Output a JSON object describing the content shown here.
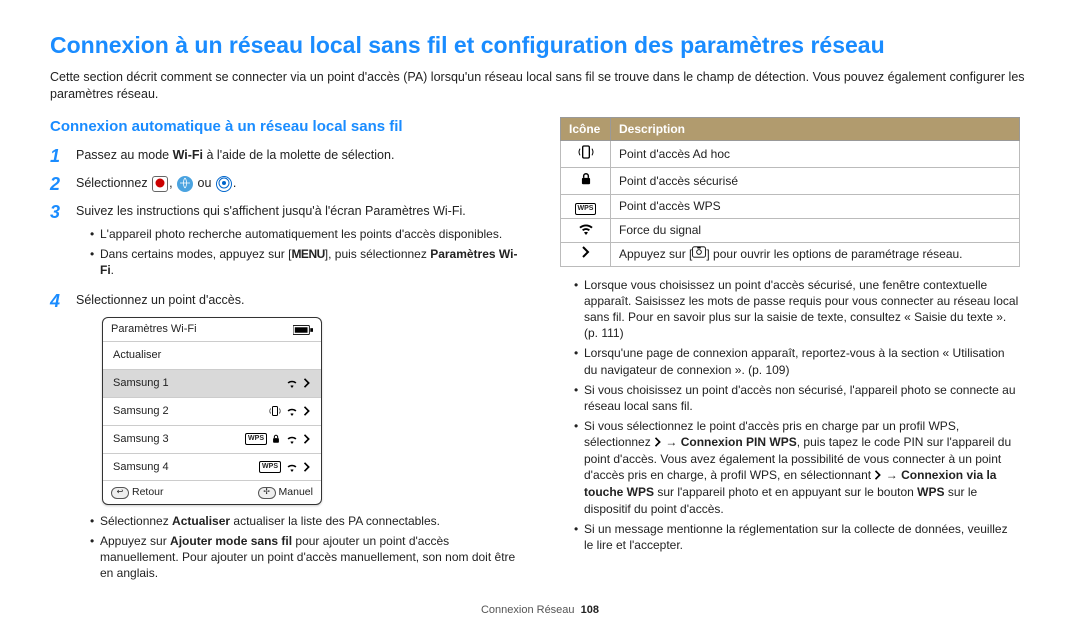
{
  "page_title": "Connexion à un réseau local sans fil et configuration des paramètres réseau",
  "intro": "Cette section décrit comment se connecter via un point d'accès (PA) lorsqu'un réseau local sans fil se trouve dans le champ de détection. Vous pouvez également configurer les paramètres réseau.",
  "subheading": "Connexion automatique à un réseau local sans fil",
  "steps": {
    "n1": "1",
    "s1_a": "Passez au mode ",
    "s1_wifi": "Wi-Fi",
    "s1_b": " à l'aide de la molette de sélection.",
    "n2": "2",
    "s2_a": "Sélectionnez ",
    "s2_b": ", ",
    "s2_c": " ou ",
    "s2_d": ".",
    "n3": "3",
    "s3": "Suivez les instructions qui s'affichent jusqu'à l'écran Paramètres Wi-Fi.",
    "s3_b1": "L'appareil photo recherche automatiquement les points d'accès disponibles.",
    "s3_b2_a": "Dans certains modes, appuyez sur [",
    "s3_b2_menu": "MENU",
    "s3_b2_b": "], puis sélectionnez ",
    "s3_b2_bold": "Paramètres Wi-Fi",
    "s3_b2_c": ".",
    "n4": "4",
    "s4": "Sélectionnez un point d'accès.",
    "s4_b1_a": "Sélectionnez ",
    "s4_b1_bold": "Actualiser",
    "s4_b1_b": " actualiser la liste des PA connectables.",
    "s4_b2_a": "Appuyez sur ",
    "s4_b2_bold": "Ajouter mode sans fil",
    "s4_b2_b": " pour ajouter un point d'accès manuellement. Pour ajouter un point d'accès manuellement, son nom doit être en anglais."
  },
  "device": {
    "title": "Paramètres Wi-Fi",
    "refresh": "Actualiser",
    "rows": [
      "Samsung 1",
      "Samsung 2",
      "Samsung 3",
      "Samsung 4"
    ],
    "back": "Retour",
    "manual": "Manuel"
  },
  "table": {
    "h_icon": "Icône",
    "h_desc": "Description",
    "r1": "Point d'accès Ad hoc",
    "r2": "Point d'accès sécurisé",
    "r3": "Point d'accès WPS",
    "r4": "Force du signal",
    "r5_a": "Appuyez sur [",
    "r5_b": "] pour ouvrir les options de paramétrage réseau."
  },
  "right_bullets": {
    "b1": "Lorsque vous choisissez un point d'accès sécurisé, une fenêtre contextuelle apparaît. Saisissez les mots de passe requis pour vous connecter au réseau local sans fil. Pour en savoir plus sur la saisie de texte, consultez « Saisie du texte ». (p. 111)",
    "b2": "Lorsqu'une page de connexion apparaît, reportez-vous à la section « Utilisation du navigateur de connexion ». (p. 109)",
    "b3": "Si vous choisissez un point d'accès non sécurisé, l'appareil photo se connecte au réseau local sans fil.",
    "b4_a": "Si vous sélectionnez le point d'accès pris en charge par un profil WPS, sélectionnez ",
    "b4_arrow": " → ",
    "b4_bold1": "Connexion PIN WPS",
    "b4_b": ", puis tapez le code PIN sur l'appareil du point d'accès. Vous avez également la possibilité de vous connecter à un point d'accès pris en charge, à profil WPS, en sélectionnant ",
    "b4_bold2": "Connexion via la touche WPS",
    "b4_c": " sur l'appareil photo et en appuyant sur le bouton ",
    "b4_bold3": "WPS",
    "b4_d": " sur le dispositif du point d'accès.",
    "b5": "Si un message mentionne la réglementation sur la collecte de données, veuillez le lire et l'accepter."
  },
  "footer": {
    "section": "Connexion Réseau",
    "page": "108"
  }
}
